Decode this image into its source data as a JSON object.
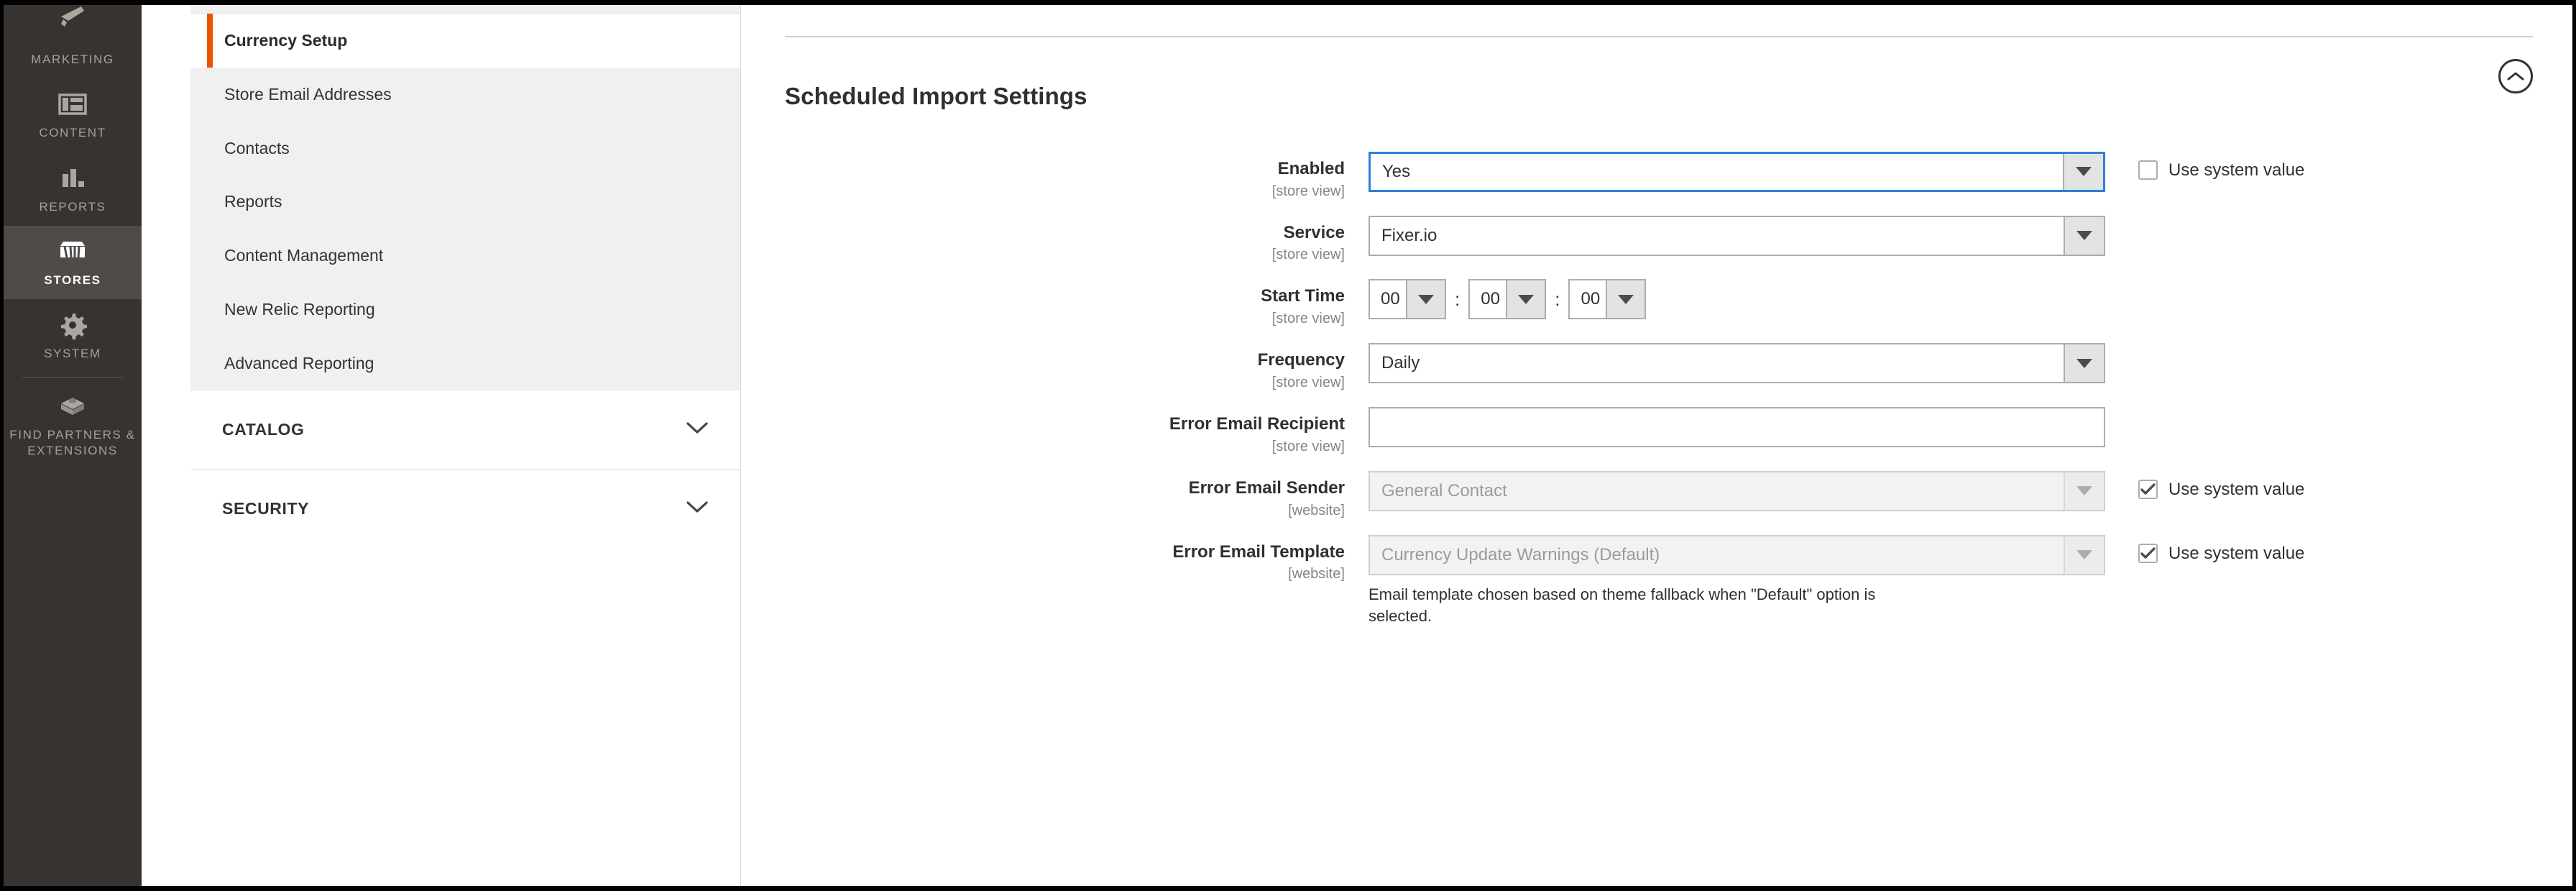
{
  "primary_nav": {
    "items": [
      {
        "label": "MARKETING",
        "icon": "megaphone-icon",
        "active": false
      },
      {
        "label": "CONTENT",
        "icon": "layout-icon",
        "active": false
      },
      {
        "label": "REPORTS",
        "icon": "bar-chart-icon",
        "active": false
      },
      {
        "label": "STORES",
        "icon": "storefront-icon",
        "active": true
      },
      {
        "label": "SYSTEM",
        "icon": "gear-icon",
        "active": false
      },
      {
        "label": "FIND PARTNERS\n& EXTENSIONS",
        "icon": "extensions-box-icon",
        "active": false
      }
    ]
  },
  "secondary_nav": {
    "items": [
      {
        "label": "Currency Setup",
        "current": true
      },
      {
        "label": "Store Email Addresses",
        "current": false
      },
      {
        "label": "Contacts",
        "current": false
      },
      {
        "label": "Reports",
        "current": false
      },
      {
        "label": "Content Management",
        "current": false
      },
      {
        "label": "New Relic Reporting",
        "current": false
      },
      {
        "label": "Advanced Reporting",
        "current": false
      }
    ],
    "sections": [
      {
        "label": "CATALOG",
        "icon": "chevron-down-icon",
        "expanded": false
      },
      {
        "label": "SECURITY",
        "icon": "chevron-down-icon",
        "expanded": false
      }
    ]
  },
  "main": {
    "section_title": "Scheduled Import Settings",
    "collapse_icon": "chevron-up-circle-icon",
    "system_value_label": "Use system value",
    "fields": [
      {
        "label": "Enabled",
        "scope": "[store view]",
        "type": "select",
        "value": "Yes",
        "focused": true,
        "disabled": false,
        "system_value": {
          "shown": true,
          "checked": false
        }
      },
      {
        "label": "Service",
        "scope": "[store view]",
        "type": "select",
        "value": "Fixer.io",
        "focused": false,
        "disabled": false,
        "system_value": {
          "shown": false,
          "checked": false
        }
      },
      {
        "label": "Start Time",
        "scope": "[store view]",
        "type": "time",
        "hours": "00",
        "minutes": "00",
        "seconds": "00",
        "separator": ":",
        "system_value": {
          "shown": false,
          "checked": false
        }
      },
      {
        "label": "Frequency",
        "scope": "[store view]",
        "type": "select",
        "value": "Daily",
        "focused": false,
        "disabled": false,
        "system_value": {
          "shown": false,
          "checked": false
        }
      },
      {
        "label": "Error Email Recipient",
        "scope": "[store view]",
        "type": "text",
        "value": "",
        "placeholder": "",
        "system_value": {
          "shown": false,
          "checked": false
        }
      },
      {
        "label": "Error Email Sender",
        "scope": "[website]",
        "type": "select",
        "value": "General Contact",
        "focused": false,
        "disabled": true,
        "system_value": {
          "shown": true,
          "checked": true
        }
      },
      {
        "label": "Error Email Template",
        "scope": "[website]",
        "type": "select",
        "value": "Currency Update Warnings (Default)",
        "focused": false,
        "disabled": true,
        "note": "Email template chosen based on theme fallback when \"Default\" option is selected.",
        "system_value": {
          "shown": true,
          "checked": true
        }
      }
    ]
  },
  "colors": {
    "accent_orange": "#eb5202",
    "sidebar_dark": "#373330",
    "focus_blue": "#2f7fd8"
  }
}
